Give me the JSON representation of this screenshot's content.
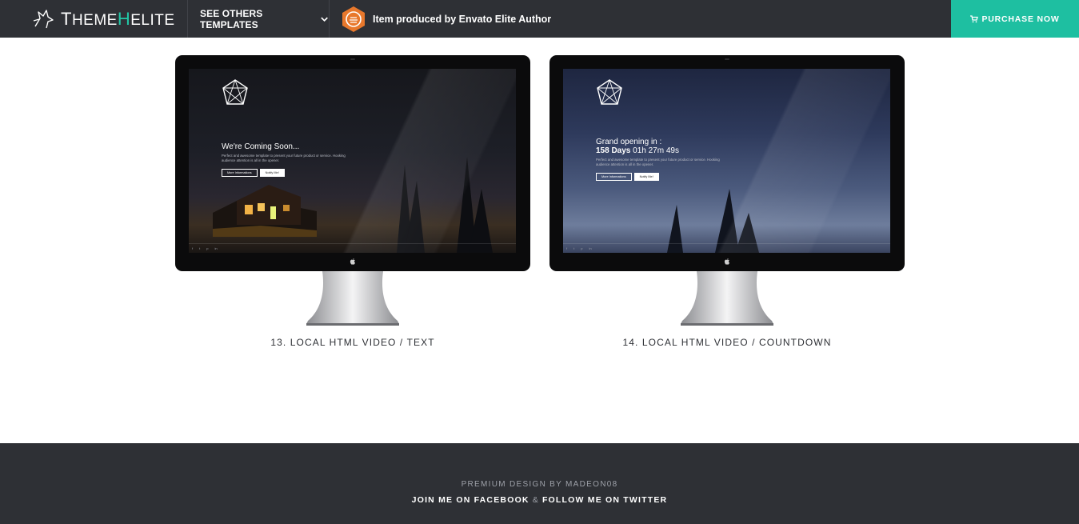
{
  "header": {
    "brand": {
      "part1_cap": "T",
      "part1": "HEME",
      "part2_cap": "H",
      "part2": "ELITE"
    },
    "templates_label": "SEE OTHERS TEMPLATES",
    "envato_label": "Item produced by Envato Elite Author",
    "purchase_label": "PURCHASE NOW"
  },
  "templates": [
    {
      "caption": "13. LOCAL HTML VIDEO / TEXT",
      "screen": {
        "title": "We're Coming Soon...",
        "subtitle": "Perfect and awesome template to present your future product or service. Hooking audience attention is all in the opener.",
        "btn_info": "More Informations",
        "btn_notify": "Notify Me!"
      }
    },
    {
      "caption": "14. LOCAL HTML VIDEO / COUNTDOWN",
      "screen": {
        "title": "Grand opening in :",
        "countdown_days": "158 Days",
        "countdown_rest": "01h 27m 49s",
        "subtitle": "Perfect and awesome template to present your future product or service. Hooking audience attention is all in the opener.",
        "btn_info": "More Informations",
        "btn_notify": "Notify Me!"
      }
    }
  ],
  "footer": {
    "credit": "PREMIUM DESIGN BY MADEON08",
    "facebook": "JOIN ME ON FACEBOOK",
    "amp": "&",
    "twitter": "FOLLOW ME ON TWITTER"
  },
  "colors": {
    "dark": "#2e3035",
    "accent": "#1ebfa1",
    "envato_orange": "#e8782c"
  },
  "icons": [
    "wolf-logo-icon",
    "chevron-down-icon",
    "envato-badge-icon",
    "cart-icon",
    "apple-icon",
    "geometric-logo-icon"
  ]
}
